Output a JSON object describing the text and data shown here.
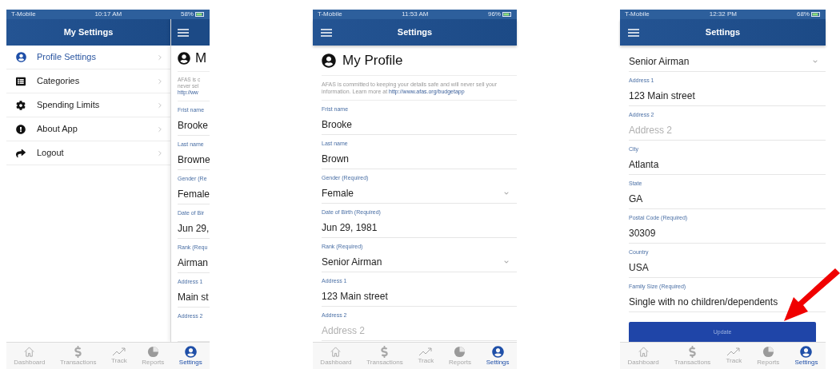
{
  "phones": [
    {
      "kind": "menu",
      "status": {
        "carrier": "T-Mobile",
        "time": "10:17 AM",
        "battery": "58%"
      },
      "header": {
        "title": "My Settings"
      },
      "menu": [
        {
          "label": "Profile Settings",
          "selected": true
        },
        {
          "label": "Categories",
          "selected": false
        },
        {
          "label": "Spending Limits",
          "selected": false
        },
        {
          "label": "About App",
          "selected": false
        },
        {
          "label": "Logout",
          "selected": false
        }
      ],
      "peek": {
        "title": "M",
        "description": "AFAS is c never sel",
        "link": "http://ww",
        "fields": [
          {
            "label": "Frist name",
            "value": "Brooke"
          },
          {
            "label": "Last name",
            "value": "Browne"
          },
          {
            "label": "Gender (Re",
            "value": "Female"
          },
          {
            "label": "Date of Bir",
            "value": "Jun 29,"
          },
          {
            "label": "Rank (Requ",
            "value": "Airman"
          },
          {
            "label": "Address 1",
            "value": "Main st"
          },
          {
            "label": "Address 2"
          }
        ]
      },
      "tabs": [
        {
          "label": "Dashboard",
          "selected": false
        },
        {
          "label": "Transactions",
          "selected": false
        },
        {
          "label": "Track",
          "selected": false
        },
        {
          "label": "Reports",
          "selected": false
        },
        {
          "label": "Settings",
          "selected": true
        }
      ]
    },
    {
      "kind": "profile",
      "status": {
        "carrier": "T-Mobile",
        "time": "11:53 AM",
        "battery": "96%"
      },
      "header": {
        "title": "Settings"
      },
      "profile": {
        "title": "My Profile",
        "description": "AFAS is committed to keeping your details safe and will never sell your information. Learn more at",
        "link": "http://www.afas.org/budgetapp"
      },
      "fields": [
        {
          "kind": "text",
          "label": "Frist name",
          "value": "Brooke"
        },
        {
          "kind": "text",
          "label": "Last name",
          "value": "Brown"
        },
        {
          "kind": "select",
          "label": "Gender (Required)",
          "value": "Female"
        },
        {
          "kind": "text",
          "label": "Date of Birth (Required)",
          "value": "Jun 29, 1981"
        },
        {
          "kind": "select",
          "label": "Rank (Required)",
          "value": "Senior Airman"
        },
        {
          "kind": "text",
          "label": "Address 1",
          "value": "123 Main street"
        },
        {
          "kind": "text",
          "label": "Address 2",
          "placeholder": "Address 2"
        }
      ],
      "tabs": [
        {
          "label": "Dashboard",
          "selected": false
        },
        {
          "label": "Transactions",
          "selected": false
        },
        {
          "label": "Track",
          "selected": false
        },
        {
          "label": "Reports",
          "selected": false
        },
        {
          "label": "Settings",
          "selected": true
        }
      ]
    },
    {
      "kind": "profile",
      "status": {
        "carrier": "T-Mobile",
        "time": "12:32 PM",
        "battery": "68%"
      },
      "header": {
        "title": "Settings"
      },
      "fields": [
        {
          "kind": "select",
          "value": "Senior Airman"
        },
        {
          "kind": "text",
          "label": "Address 1",
          "value": "123 Main street"
        },
        {
          "kind": "text",
          "label": "Address 2",
          "placeholder": "Address 2"
        },
        {
          "kind": "text",
          "label": "City",
          "value": "Atlanta"
        },
        {
          "kind": "text",
          "label": "State",
          "value": "GA"
        },
        {
          "kind": "text",
          "label": "Postal Code (Required)",
          "value": "30309"
        },
        {
          "kind": "text",
          "label": "Country",
          "value": "USA"
        },
        {
          "kind": "text",
          "label": "Family Size (Required)",
          "value": "Single with no children/dependents"
        }
      ],
      "button": {
        "label": "Update"
      },
      "tabs": [
        {
          "label": "Dashboard",
          "selected": false
        },
        {
          "label": "Transactions",
          "selected": false
        },
        {
          "label": "Track",
          "selected": false
        },
        {
          "label": "Reports",
          "selected": false
        },
        {
          "label": "Settings",
          "selected": true
        }
      ]
    }
  ]
}
